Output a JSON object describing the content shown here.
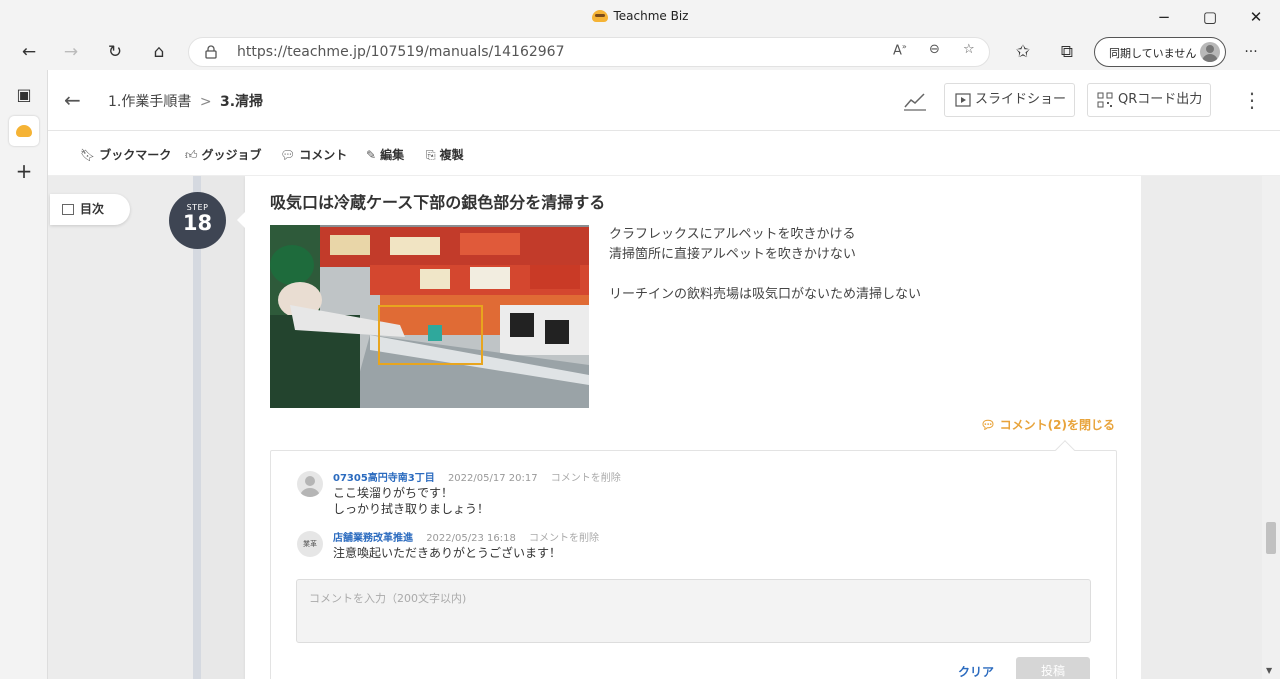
{
  "window": {
    "title": "Teachme Biz",
    "minimize": "−",
    "maximize": "▢",
    "close": "✕"
  },
  "browser": {
    "url": "https://teachme.jp/107519/manuals/14162967",
    "profile_label": "同期していません",
    "more": "···"
  },
  "app": {
    "breadcrumb_parent": "1.作業手順書",
    "breadcrumb_sep": ">",
    "breadcrumb_current": "3.清掃",
    "slideshow_label": "スライドショー",
    "qr_label": "QRコード出力",
    "toolbar": {
      "bookmark": "ブックマーク",
      "goodjob": "グッジョブ",
      "comment": "コメント",
      "edit": "編集",
      "copy": "複製"
    },
    "toc_label": "目次",
    "step": {
      "prefix": "STEP",
      "number": "18",
      "title": "吸気口は冷蔵ケース下部の銀色部分を清掃する",
      "lines": [
        "クラフレックスにアルペットを吹きかける",
        "清掃箇所に直接アルペットを吹きかけない",
        "",
        "リーチインの飲料売場は吸気口がないため清掃しない"
      ],
      "comment_toggle": "コメント(2)を閉じる"
    },
    "comments": [
      {
        "user": "07305高円寺南3丁目",
        "date": "2022/05/17 20:17",
        "delete": "コメントを削除",
        "lines": [
          "ここ埃溜りがちです！",
          "しっかり拭き取りましょう！"
        ],
        "avatar_text": ""
      },
      {
        "user": "店舗業務改革推進",
        "date": "2022/05/23 16:18",
        "delete": "コメントを削除",
        "lines": [
          "注意喚起いただきありがとうございます！"
        ],
        "avatar_text": "業革"
      }
    ],
    "comment_input_placeholder": "コメントを入力（200文字以内)",
    "clear_label": "クリア",
    "post_label": "投稿"
  },
  "colors": {
    "accent_orange": "#e8a33a",
    "link_blue": "#2b6bbf",
    "step_circle": "#3e4553"
  }
}
